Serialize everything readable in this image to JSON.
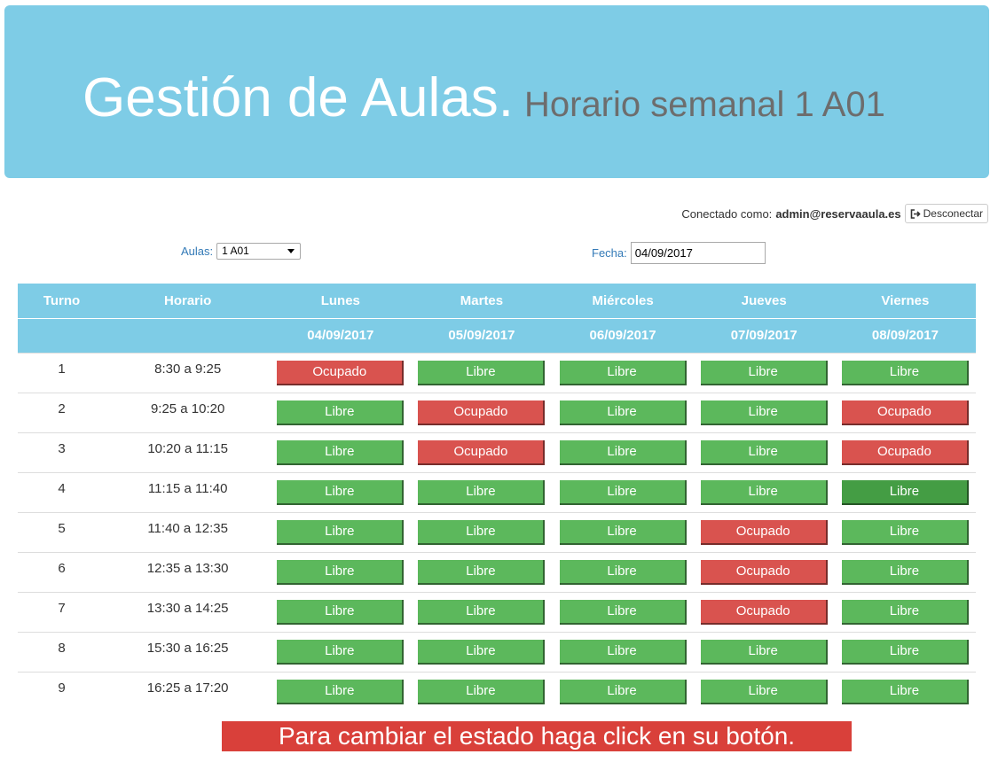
{
  "header": {
    "title": "Gestión de Aulas.",
    "subtitle": "Horario semanal 1 A01"
  },
  "session": {
    "label": "Conectado como:",
    "user": "admin@reservaaula.es",
    "logout_label": "Desconectar"
  },
  "filters": {
    "aula_label": "Aulas:",
    "aula_value": "1 A01",
    "fecha_label": "Fecha:",
    "fecha_value": "04/09/2017"
  },
  "table": {
    "headers": {
      "turno": "Turno",
      "horario": "Horario"
    },
    "days": [
      {
        "name": "Lunes",
        "date": "04/09/2017"
      },
      {
        "name": "Martes",
        "date": "05/09/2017"
      },
      {
        "name": "Miércoles",
        "date": "06/09/2017"
      },
      {
        "name": "Jueves",
        "date": "07/09/2017"
      },
      {
        "name": "Viernes",
        "date": "08/09/2017"
      }
    ],
    "rows": [
      {
        "turno": "1",
        "horario": "8:30 a 9:25",
        "slots": [
          "Ocupado",
          "Libre",
          "Libre",
          "Libre",
          "Libre"
        ]
      },
      {
        "turno": "2",
        "horario": "9:25 a 10:20",
        "slots": [
          "Libre",
          "Ocupado",
          "Libre",
          "Libre",
          "Ocupado"
        ]
      },
      {
        "turno": "3",
        "horario": "10:20 a 11:15",
        "slots": [
          "Libre",
          "Ocupado",
          "Libre",
          "Libre",
          "Ocupado"
        ]
      },
      {
        "turno": "4",
        "horario": "11:15 a 11:40",
        "slots": [
          "Libre",
          "Libre",
          "Libre",
          "Libre",
          "Libre"
        ]
      },
      {
        "turno": "5",
        "horario": "11:40 a 12:35",
        "slots": [
          "Libre",
          "Libre",
          "Libre",
          "Ocupado",
          "Libre"
        ]
      },
      {
        "turno": "6",
        "horario": "12:35 a 13:30",
        "slots": [
          "Libre",
          "Libre",
          "Libre",
          "Ocupado",
          "Libre"
        ]
      },
      {
        "turno": "7",
        "horario": "13:30 a 14:25",
        "slots": [
          "Libre",
          "Libre",
          "Libre",
          "Ocupado",
          "Libre"
        ]
      },
      {
        "turno": "8",
        "horario": "15:30 a 16:25",
        "slots": [
          "Libre",
          "Libre",
          "Libre",
          "Libre",
          "Libre"
        ]
      },
      {
        "turno": "9",
        "horario": "16:25 a 17:20",
        "slots": [
          "Libre",
          "Libre",
          "Libre",
          "Libre",
          "Libre"
        ]
      }
    ]
  },
  "notice": "Para cambiar el estado haga click en su botón.",
  "colors": {
    "header_bg": "#7ecce6",
    "libre": "#5cb85c",
    "ocupado": "#d9534f",
    "notice_bg": "#d9403a"
  }
}
